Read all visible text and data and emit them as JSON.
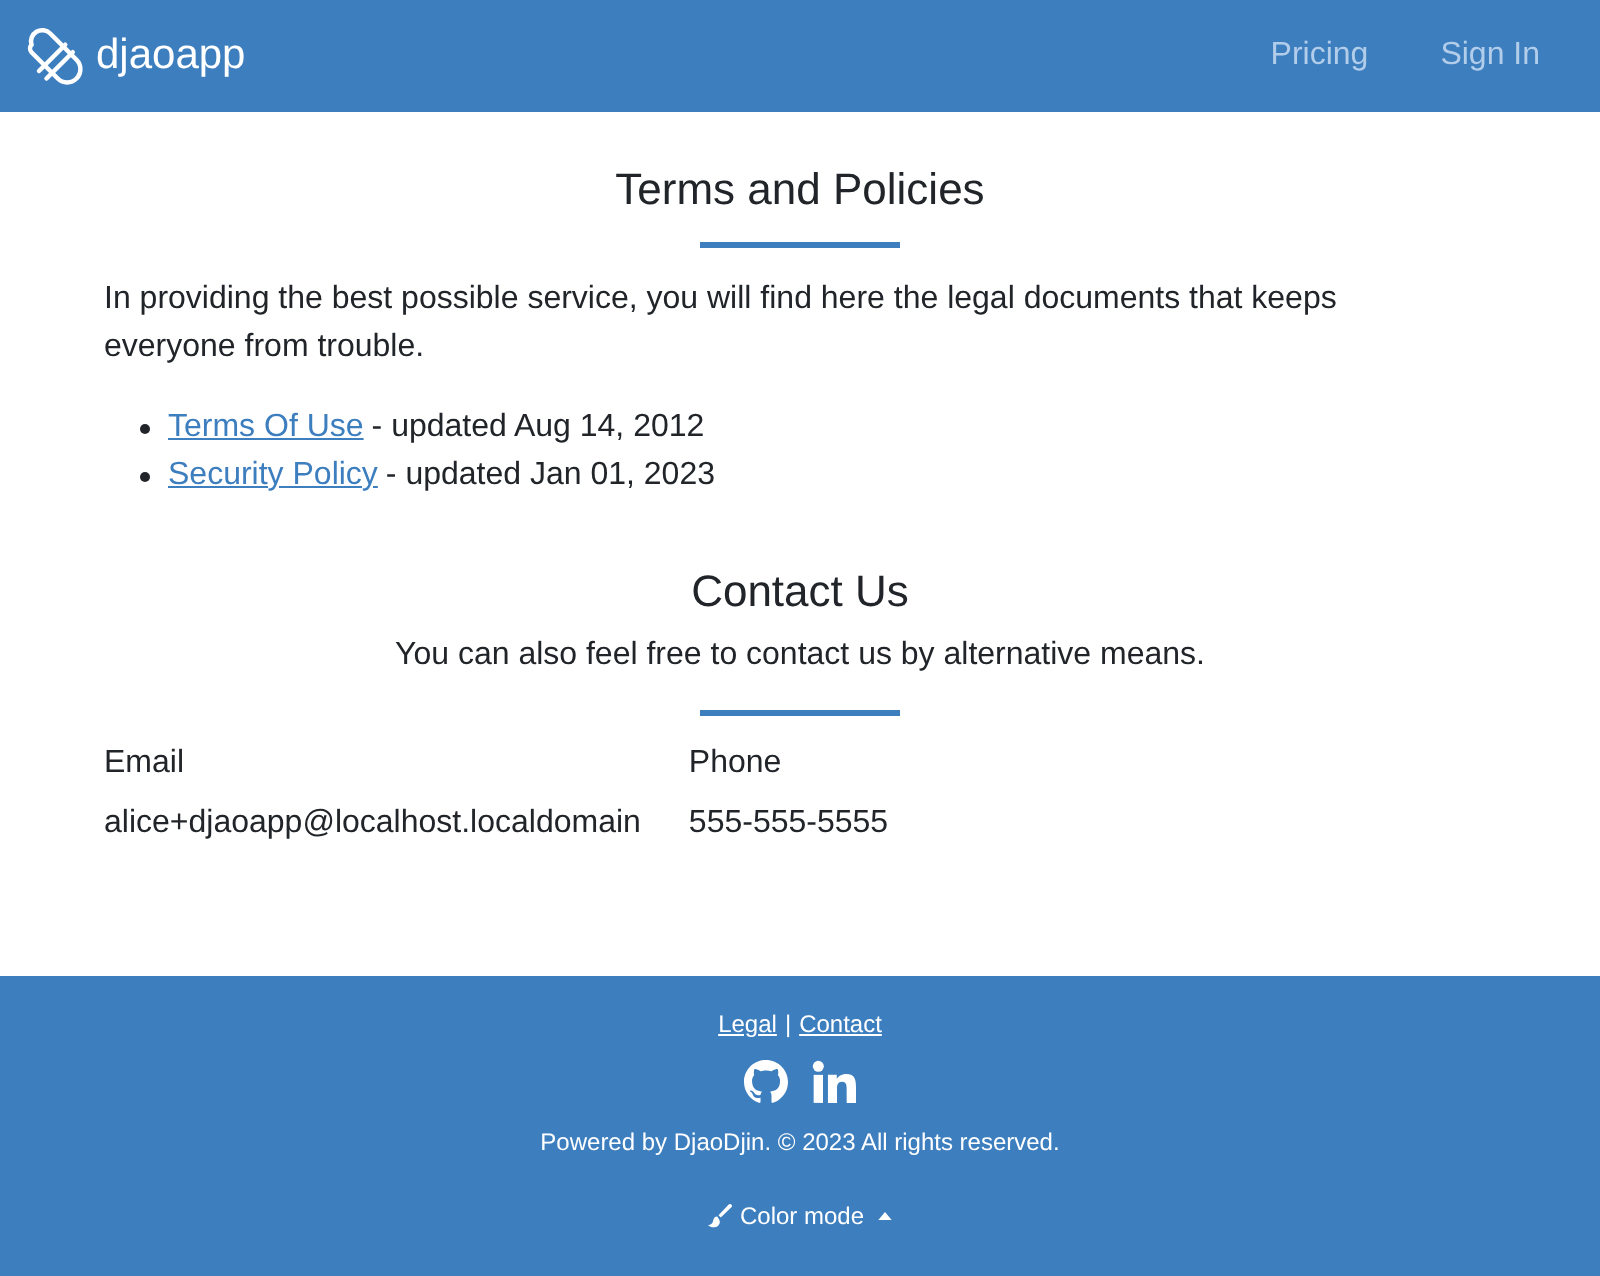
{
  "header": {
    "brand": "djaoapp",
    "nav": [
      {
        "label": "Pricing"
      },
      {
        "label": "Sign In"
      }
    ]
  },
  "terms": {
    "title": "Terms and Policies",
    "intro": "In providing the best possible service, you will find here the legal documents that keeps everyone from trouble.",
    "documents": [
      {
        "link": "Terms Of Use",
        "note": "- updated Aug 14, 2012"
      },
      {
        "link": "Security Policy",
        "note": "- updated Jan 01, 2023"
      }
    ]
  },
  "contact": {
    "title": "Contact Us",
    "subtitle": "You can also feel free to contact us by alternative means.",
    "fields": [
      {
        "label": "Email",
        "value": "alice+djaoapp@localhost.localdomain"
      },
      {
        "label": "Phone",
        "value": "555-555-5555"
      }
    ]
  },
  "footer": {
    "links": [
      "Legal",
      "Contact"
    ],
    "separator": "|",
    "copyright": "Powered by DjaoDjin. © 2023 All rights reserved.",
    "color_mode": "Color mode"
  }
}
